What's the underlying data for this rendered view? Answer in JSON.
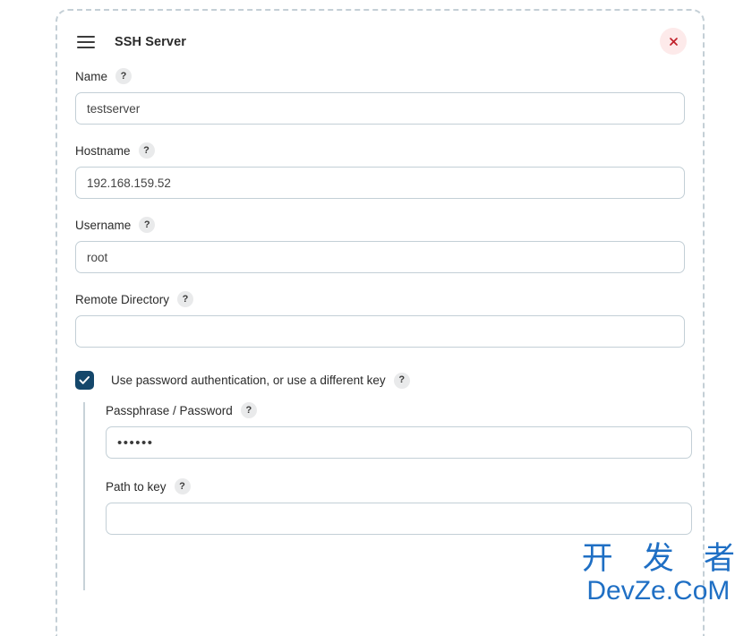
{
  "panel": {
    "title": "SSH Server",
    "menu_icon": "hamburger-icon",
    "close_icon": "close-icon"
  },
  "help_glyph": "?",
  "fields": [
    {
      "label": "Name",
      "value": "testserver",
      "placeholder": ""
    },
    {
      "label": "Hostname",
      "value": "192.168.159.52",
      "placeholder": ""
    },
    {
      "label": "Username",
      "value": "root",
      "placeholder": ""
    },
    {
      "label": "Remote Directory",
      "value": "",
      "placeholder": ""
    }
  ],
  "checkbox": {
    "label": "Use password authentication, or use a different key",
    "checked": true
  },
  "nested_fields": [
    {
      "label": "Passphrase / Password",
      "value": "••••••",
      "placeholder": ""
    },
    {
      "label": "Path to key",
      "value": "",
      "placeholder": ""
    }
  ],
  "watermark": {
    "chinese": "开 发 者",
    "latin": "DevZe.CoM",
    "color": "#1f6fc4"
  },
  "colors": {
    "accent_checkbox": "#14476b",
    "input_border": "#c3cfd6",
    "panel_border": "#c4cfd6",
    "close_bg": "#fdeaea",
    "close_x": "#c0202a"
  }
}
